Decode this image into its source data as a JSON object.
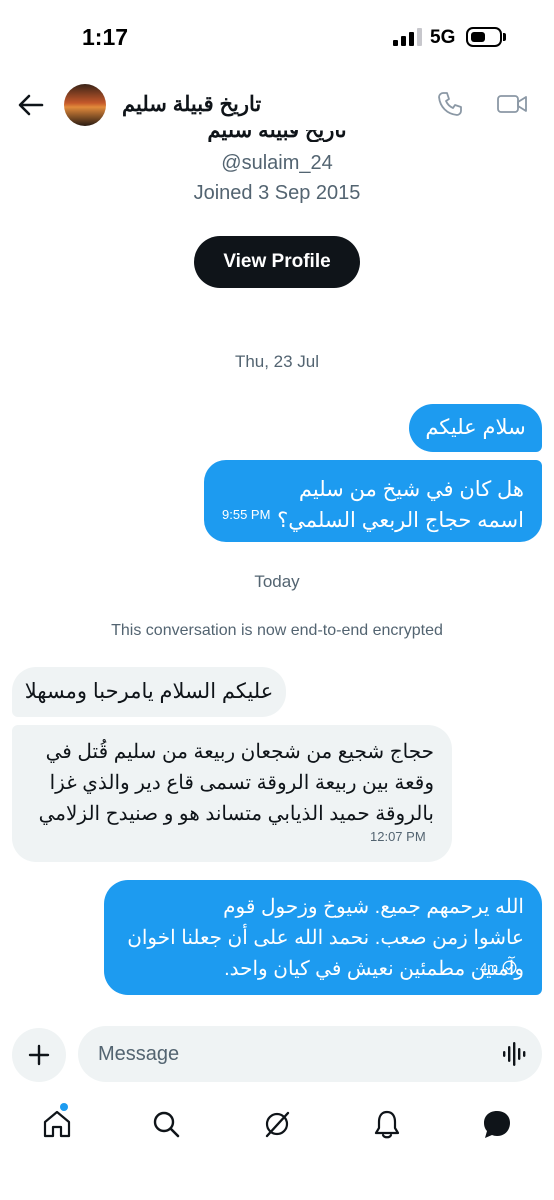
{
  "status_bar": {
    "time": "1:17",
    "network": "5G"
  },
  "header": {
    "name": "تاريخ قبيلة سليم"
  },
  "profile": {
    "name": "تاريخ قبيلة سليم",
    "handle": "@sulaim_24",
    "joined": "Joined 3 Sep 2015",
    "view_profile_label": "View Profile"
  },
  "conversation": {
    "date_1": "Thu, 23 Jul",
    "date_2": "Today",
    "encryption_notice": "This conversation is now end-to-end encrypted",
    "messages": [
      {
        "from": "me",
        "text": "سلام عليكم",
        "time": ""
      },
      {
        "from": "me",
        "lines": [
          "هل كان في شيخ من سليم",
          "اسمه حجاج الربعي السلمي؟"
        ],
        "time": "9:55 PM"
      },
      {
        "from": "them",
        "text": "عليكم السلام يامرحبا ومسهلا",
        "time": ""
      },
      {
        "from": "them",
        "lines": [
          "حجاج شجيع من شجعان ربيعة من سليم قُتل في",
          "وقعة بين ربيعة الروقة تسمى قاع دير والذي غزا",
          "بالروقة حميد الذيابي متساند هو و صنيدح الزلامي"
        ],
        "time": "12:07 PM"
      },
      {
        "from": "me",
        "lines": [
          "الله يرحمهم جميع. شيوخ وزحول قوم",
          "عاشوا زمن صعب. نحمد الله على أن جعلنا اخوان",
          "وآمنين مطمئين نعيش في كيان واحد."
        ],
        "time": "4m"
      }
    ]
  },
  "composer": {
    "placeholder": "Message"
  },
  "nav": {
    "items": [
      "home-icon",
      "search-icon",
      "grok-icon",
      "notifications-icon",
      "messages-icon"
    ]
  },
  "colors": {
    "accent": "#1d9bf0",
    "incoming_bubble": "#eff3f4",
    "text": "#0f1419",
    "muted": "#536471"
  }
}
